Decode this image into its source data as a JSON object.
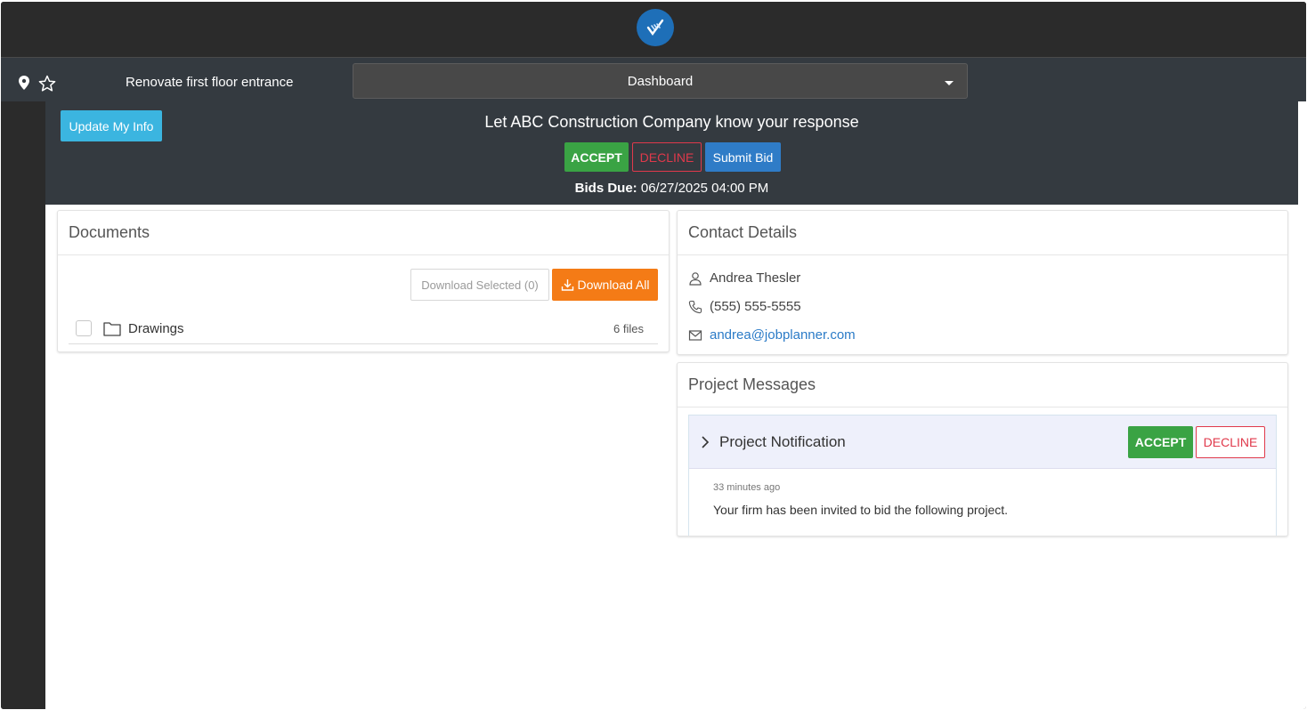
{
  "topbar": {
    "logo_icon": "jobplanner-logo-icon"
  },
  "navbar": {
    "project_name": "Renovate first floor entrance",
    "view_select": "Dashboard"
  },
  "banner": {
    "update_info_label": "Update My Info",
    "title": "Let ABC Construction Company know your response",
    "accept_label": "ACCEPT",
    "decline_label": "DECLINE",
    "submit_label": "Submit Bid",
    "bids_due_label": "Bids Due:",
    "bids_due_value": "06/27/2025 04:00 PM"
  },
  "documents": {
    "title": "Documents",
    "download_selected_label": "Download Selected (0)",
    "download_all_label": "Download All",
    "folders": [
      {
        "name": "Drawings",
        "count": "6 files"
      }
    ]
  },
  "contact": {
    "title": "Contact Details",
    "name": "Andrea Thesler",
    "phone": "(555) 555-5555",
    "email": "andrea@jobplanner.com"
  },
  "messages": {
    "title": "Project Messages",
    "items": [
      {
        "title": "Project Notification",
        "accept_label": "ACCEPT",
        "decline_label": "DECLINE",
        "time": "33 minutes ago",
        "body": "Your firm has been invited to bid the following project."
      }
    ]
  },
  "colors": {
    "accept": "#3aa344",
    "decline": "#e0394b",
    "submit": "#2f7cc7",
    "download_all": "#f47b16",
    "update_info": "#3bb5e0",
    "link": "#2b7bc7"
  }
}
